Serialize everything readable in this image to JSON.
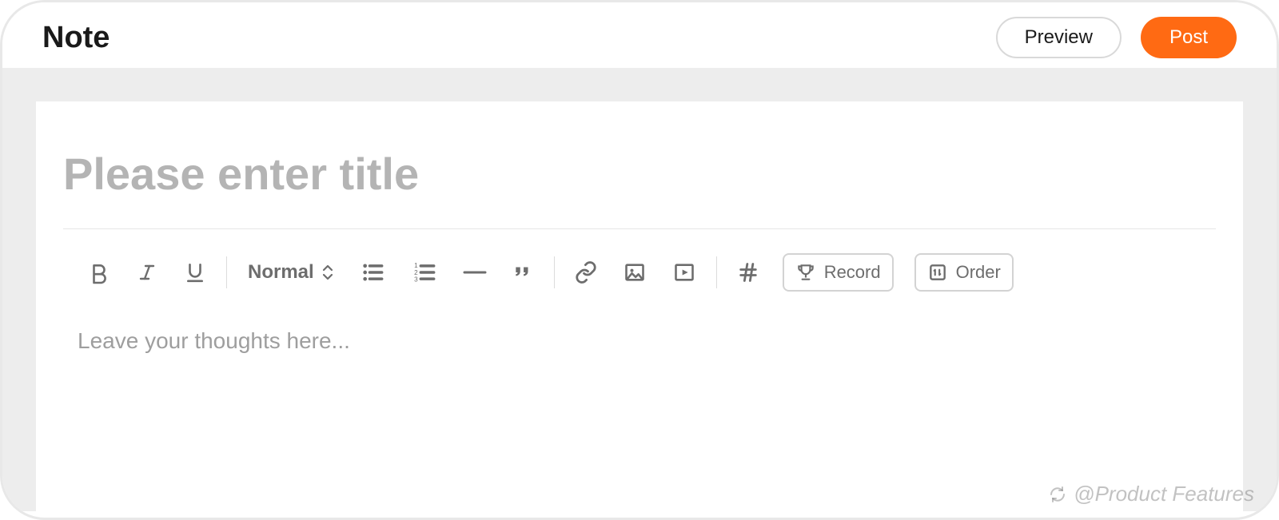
{
  "header": {
    "title": "Note",
    "preview_label": "Preview",
    "post_label": "Post"
  },
  "editor": {
    "title_placeholder": "Please enter title",
    "body_placeholder": "Leave your thoughts here...",
    "format_select": "Normal",
    "record_label": "Record",
    "order_label": "Order"
  },
  "watermark": "@Product Features",
  "colors": {
    "accent": "#ff6a13"
  }
}
